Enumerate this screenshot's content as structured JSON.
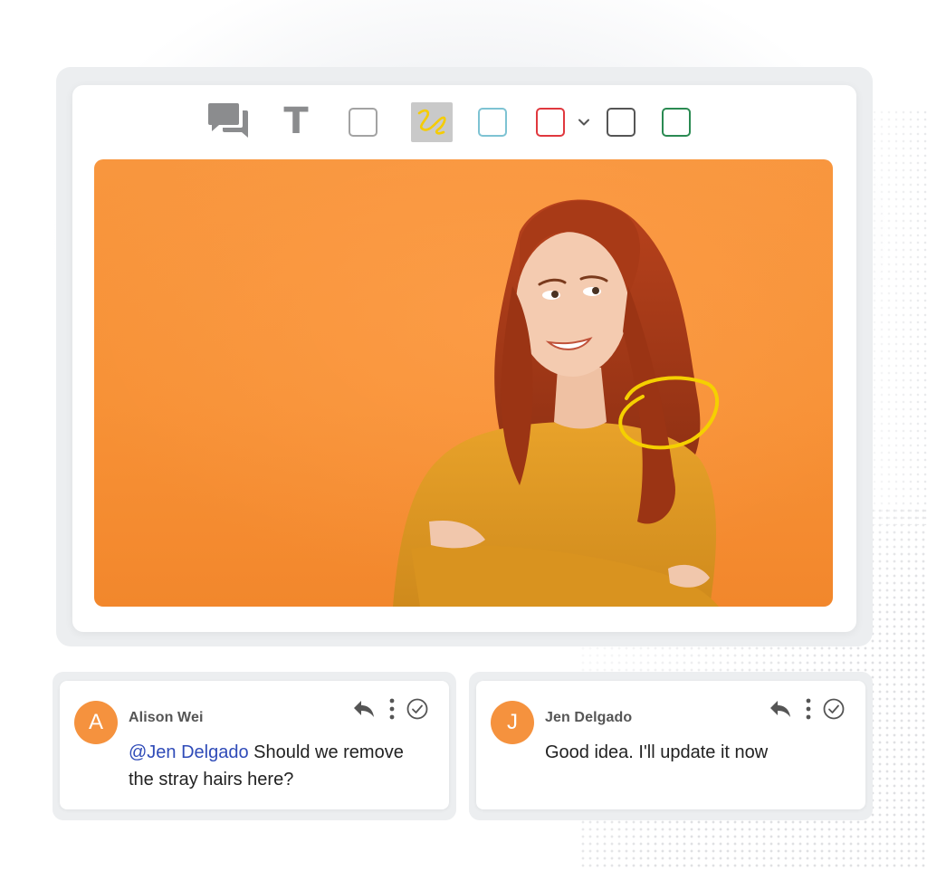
{
  "toolbar": {
    "tools": [
      {
        "name": "comments",
        "icon": "comments-icon"
      },
      {
        "name": "text",
        "icon": "text-icon",
        "glyph": "T"
      },
      {
        "name": "rectangle-gray",
        "color": "#999999"
      },
      {
        "name": "freehand-draw",
        "icon": "squiggle-icon",
        "color": "#f2cc00",
        "active": true
      },
      {
        "name": "rectangle-blue",
        "color": "#7ec3d3"
      },
      {
        "name": "rectangle-red",
        "color": "#e0383e"
      },
      {
        "name": "color-dropdown",
        "icon": "chevron-down-icon"
      },
      {
        "name": "rectangle-dark",
        "color": "#555555"
      },
      {
        "name": "rectangle-green",
        "color": "#2a8a52"
      }
    ]
  },
  "canvas": {
    "background_color": "#f79136",
    "annotation_color": "#f5d000"
  },
  "comments": [
    {
      "avatar_letter": "A",
      "author": "Alison Wei",
      "mention": "@Jen Delgado",
      "text": " Should we remove the stray hairs here?"
    },
    {
      "avatar_letter": "J",
      "author": "Jen Delgado",
      "mention": "",
      "text": "Good idea. I'll update it now"
    }
  ],
  "colors": {
    "accent": "#f5923e",
    "mention": "#2f4bb8"
  }
}
